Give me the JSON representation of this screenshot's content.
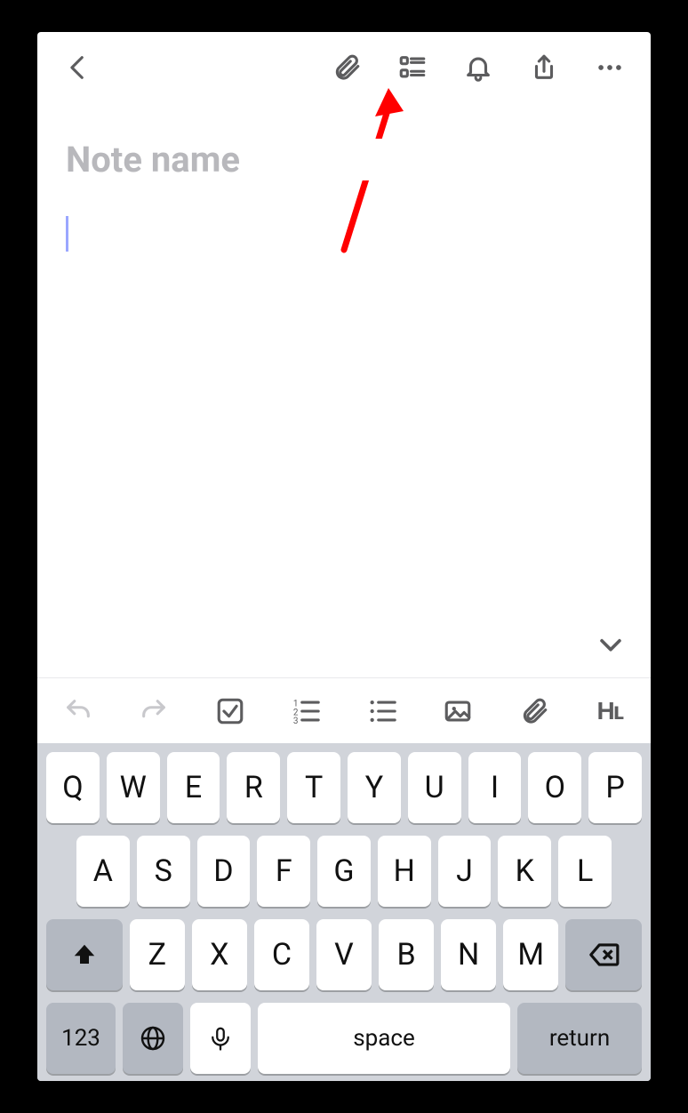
{
  "header": {
    "back": "back",
    "attach": "attachment",
    "template": "template-list",
    "reminder": "reminder",
    "share": "share",
    "more": "more"
  },
  "note": {
    "title_placeholder": "Note name",
    "title_value": "",
    "body_value": ""
  },
  "format_toolbar": {
    "undo": "undo",
    "redo": "redo",
    "checkbox": "checkbox",
    "numbered": "numbered-list",
    "bulleted": "bulleted-list",
    "image": "insert-image",
    "attach": "attach-file",
    "heading": "Hʟ"
  },
  "keyboard": {
    "row1": [
      "Q",
      "W",
      "E",
      "R",
      "T",
      "Y",
      "U",
      "I",
      "O",
      "P"
    ],
    "row2": [
      "A",
      "S",
      "D",
      "F",
      "G",
      "H",
      "J",
      "K",
      "L"
    ],
    "row3": [
      "Z",
      "X",
      "C",
      "V",
      "B",
      "N",
      "M"
    ],
    "shift": "shift",
    "backspace": "backspace",
    "numbers": "123",
    "globe": "globe",
    "mic": "dictation",
    "space": "space",
    "return": "return"
  }
}
